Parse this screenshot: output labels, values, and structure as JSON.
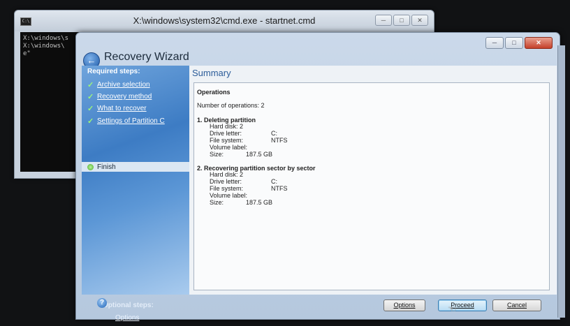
{
  "cmd": {
    "title": "X:\\windows\\system32\\cmd.exe - startnet.cmd",
    "lines": [
      "X:\\windows\\s",
      "X:\\windows\\",
      "e\""
    ]
  },
  "wizard": {
    "title": "Recovery Wizard",
    "sidebar": {
      "heading": "Required steps:",
      "steps": [
        "Archive selection",
        "Recovery method",
        "What to recover",
        "Settings of Partition C"
      ],
      "current": "Finish",
      "optional_heading": "Optional steps:",
      "optional_link": "Options"
    },
    "main": {
      "title": "Summary",
      "operations_heading": "Operations",
      "num_operations": "Number of operations: 2",
      "op1": {
        "title": "1. Deleting partition",
        "hard_disk": "Hard disk:  2",
        "drive_letter_label": "Drive letter:",
        "drive_letter": "C:",
        "file_system_label": "File system:",
        "file_system": "NTFS",
        "volume_label_label": "Volume label:",
        "size_label": "Size:",
        "size": "187.5 GB"
      },
      "op2": {
        "title": "2. Recovering partition sector by sector",
        "hard_disk": "Hard disk:  2",
        "drive_letter_label": "Drive letter:",
        "drive_letter": "C:",
        "file_system_label": "File system:",
        "file_system": "NTFS",
        "volume_label_label": "Volume label:",
        "size_label": "Size:",
        "size": "187.5 GB"
      }
    },
    "buttons": {
      "options": "Options",
      "proceed": "Proceed",
      "cancel": "Cancel"
    },
    "icons": {
      "back": "back-arrow-icon",
      "help": "help-icon"
    }
  }
}
